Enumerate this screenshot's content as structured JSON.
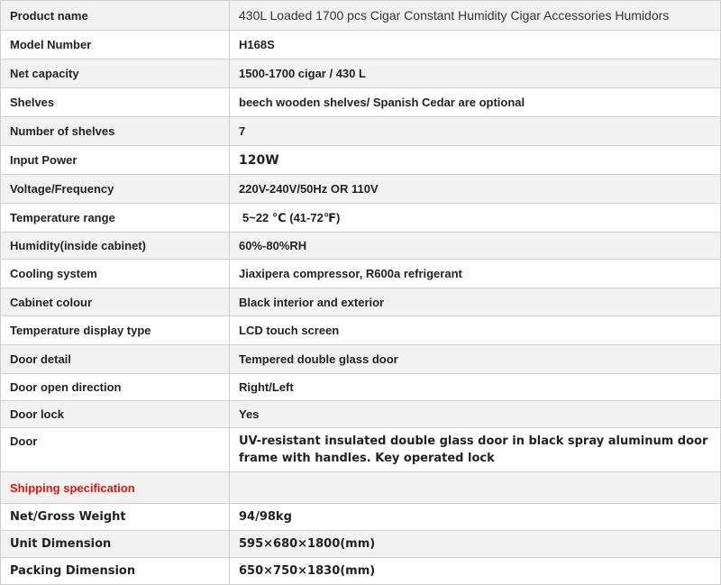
{
  "accent_color": "#e3120b",
  "rows": [
    {
      "label": "Product name",
      "value": "430L Loaded 1700 pcs Cigar Constant Humidity Cigar Accessories Humidors"
    },
    {
      "label": "Model Number",
      "value": "H168S"
    },
    {
      "label": "Net capacity",
      "value": "1500-1700 cigar / 430 L"
    },
    {
      "label": "Shelves",
      "value": "beech wooden shelves/ Spanish Cedar are optional"
    },
    {
      "label": "Number of shelves",
      "value": "7"
    },
    {
      "label": "Input Power",
      "value": "120W"
    },
    {
      "label": "Voltage/Frequency",
      "value": "220V-240V/50Hz OR 110V"
    },
    {
      "label": "Temperature range",
      "value": "5~22 ℃ (41-72℉)"
    },
    {
      "label": "Humidity(inside cabinet)",
      "value": "60%-80%RH"
    },
    {
      "label": "Cooling system",
      "value": "Jiaxipera compressor, R600a refrigerant"
    },
    {
      "label": "Cabinet colour",
      "value": "Black interior and exterior"
    },
    {
      "label": "Temperature display type",
      "value": "LCD touch screen"
    },
    {
      "label": "Door detail",
      "value": "Tempered double  glass door"
    },
    {
      "label": "Door open direction",
      "value": "Right/Left"
    },
    {
      "label": "Door lock",
      "value": "Yes"
    },
    {
      "label": "Door",
      "value": "UV-resistant insulated double glass door in black spray aluminum door frame with handles. Key operated lock"
    },
    {
      "label": "Shipping specification",
      "value": ""
    },
    {
      "label": "Net/Gross Weight",
      "value": "94/98kg"
    },
    {
      "label": "Unit Dimension",
      "value": "595×680×1800(mm)"
    },
    {
      "label": "Packing Dimension",
      "value": "650×750×1830(mm)"
    }
  ]
}
